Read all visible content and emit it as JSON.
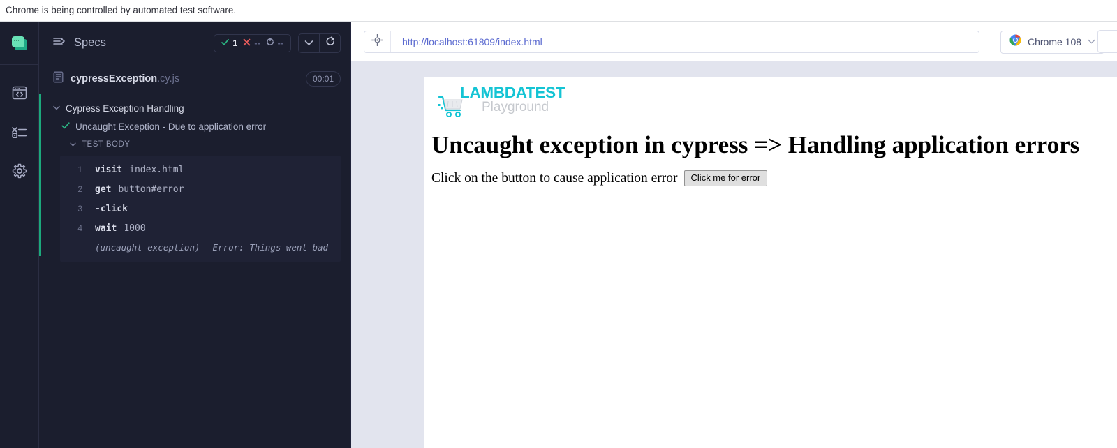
{
  "browser_banner": {
    "message": "Chrome is being controlled by automated test software."
  },
  "rail": {
    "items": [
      {
        "name": "cypress-logo",
        "label": "Cypress"
      },
      {
        "name": "specs-icon",
        "label": "Specs"
      },
      {
        "name": "runs-icon",
        "label": "Runs"
      },
      {
        "name": "settings-icon",
        "label": "Settings"
      }
    ]
  },
  "specs_panel": {
    "header": {
      "title": "Specs",
      "menu_icon": "list-arrow-icon",
      "stats": [
        {
          "icon": "check-icon",
          "value": "1",
          "color": "#2bb583",
          "kind": "passed"
        },
        {
          "icon": "x-icon",
          "value": "--",
          "color": "#e45b5b",
          "kind": "failed"
        },
        {
          "icon": "reload-icon",
          "value": "--",
          "color": "#9398b4",
          "kind": "pending"
        }
      ],
      "collapse_button": "chevron-down-icon",
      "reload_button": "refresh-icon"
    },
    "spec": {
      "file_icon": "document-icon",
      "name": "cypressException",
      "extension": ".cy.js",
      "duration": "00:01"
    },
    "tree": {
      "suite": {
        "label": "Cypress Exception Handling",
        "expanded": true
      },
      "test": {
        "label": "Uncaught Exception - Due to application error",
        "status": "passed"
      },
      "test_body_label": "TEST BODY",
      "accent_color": "#1ca97c",
      "commands": [
        {
          "number": "1",
          "name": "visit",
          "arg": "index.html"
        },
        {
          "number": "2",
          "name": "get",
          "arg": "button#error"
        },
        {
          "number": "3",
          "name": "-click",
          "arg": ""
        },
        {
          "number": "4",
          "name": "wait",
          "arg": "1000"
        }
      ],
      "error": {
        "type": "(uncaught exception)",
        "message": "Error: Things went bad"
      }
    }
  },
  "preview": {
    "url_bar": {
      "selector_icon": "crosshair-icon",
      "url": "http://localhost:61809/index.html"
    },
    "browser_selector": {
      "icon": "chrome-icon",
      "label": "Chrome 108",
      "chevron": "chevron-down-icon"
    },
    "aut": {
      "logo": {
        "icon": "shopping-cart-icon",
        "wordmark": "LAMBDATEST",
        "subtitle": "Playground",
        "wordmark_color": "#14c4d4"
      },
      "heading": "Uncaught exception in cypress => Handling application errors",
      "paragraph": "Click on the button to cause application error",
      "button_label": "Click me for error"
    }
  }
}
